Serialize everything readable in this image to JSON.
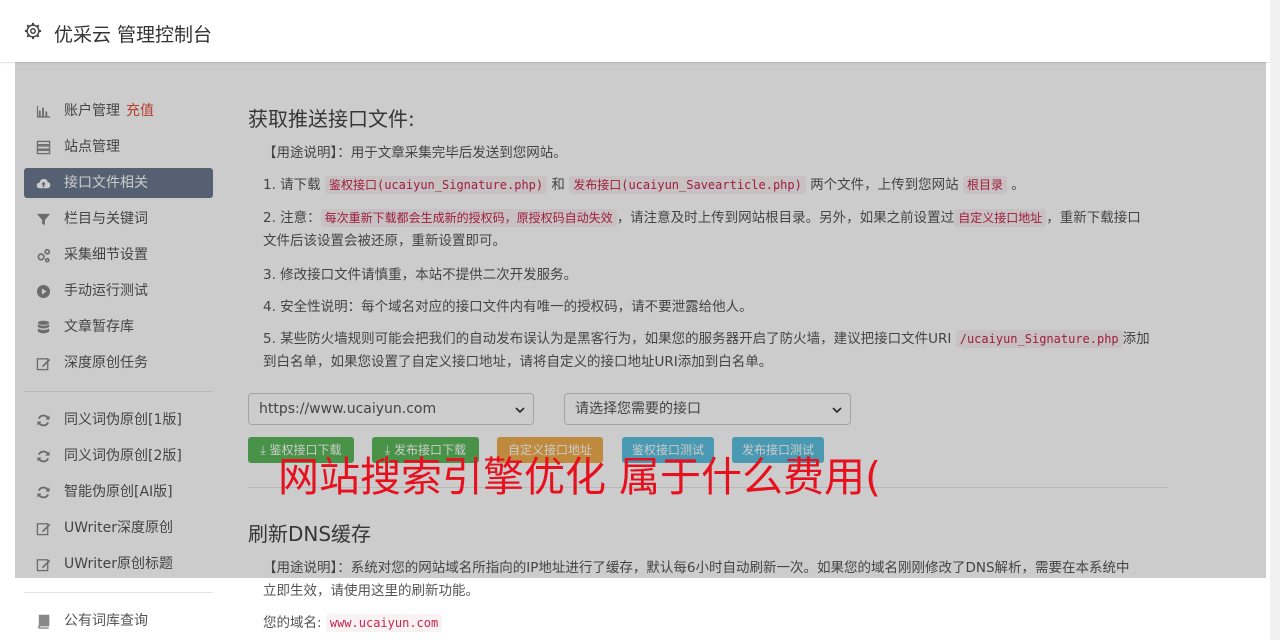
{
  "header": {
    "title": "优采云 管理控制台"
  },
  "sidebar": {
    "items": [
      {
        "label": "账户管理",
        "extra": "充值",
        "icon": "bar-chart-icon"
      },
      {
        "label": "站点管理",
        "icon": "server-icon"
      },
      {
        "label": "接口文件相关",
        "icon": "cloud-upload-icon",
        "active": true
      },
      {
        "label": "栏目与关键词",
        "icon": "filter-icon"
      },
      {
        "label": "采集细节设置",
        "icon": "cogs-icon"
      },
      {
        "label": "手动运行测试",
        "icon": "play-circle-icon"
      },
      {
        "label": "文章暂存库",
        "icon": "database-icon"
      },
      {
        "label": "深度原创任务",
        "icon": "edit-icon"
      },
      {
        "label": "同义词伪原创[1版]",
        "icon": "refresh-icon"
      },
      {
        "label": "同义词伪原创[2版]",
        "icon": "refresh-icon"
      },
      {
        "label": "智能伪原创[AI版]",
        "icon": "refresh-icon"
      },
      {
        "label": "UWriter深度原创",
        "icon": "edit-icon"
      },
      {
        "label": "UWriter原创标题",
        "icon": "edit-icon"
      },
      {
        "label": "公有词库查询",
        "icon": "book-icon"
      }
    ]
  },
  "main": {
    "section1_title": "获取推送接口文件:",
    "usage_label": "【用途说明】",
    "usage_text": "：用于文章采集完毕后发送到您网站。",
    "item1_a": "1. 请下载 ",
    "item1_code1": "鉴权接口(ucaiyun_Signature.php)",
    "item1_b": " 和 ",
    "item1_code2": "发布接口(ucaiyun_Savearticle.php)",
    "item1_c": " 两个文件，上传到您网站 ",
    "item1_code3": "根目录",
    "item1_d": " 。",
    "item2_a": "2. 注意：",
    "item2_code1": "每次重新下载都会生成新的授权码，原授权码自动失效",
    "item2_b": "，请注意及时上传到网站根目录。另外，如果之前设置过",
    "item2_code2": "自定义接口地址",
    "item2_c": "，重新下载接口文件后该设置会被还原，重新设置即可。",
    "item3": "3. 修改接口文件请慎重，本站不提供二次开发服务。",
    "item4": "4. 安全性说明：每个域名对应的接口文件内有唯一的授权码，请不要泄露给他人。",
    "item5_a": "5. 某些防火墙规则可能会把我们的自动发布误认为是黑客行为，如果您的服务器开启了防火墙，建议把接口文件URI ",
    "item5_code": "/ucaiyun_Signature.php",
    "item5_b": "添加到白名单，如果您设置了自定义接口地址，请将自定义的接口地址URI添加到白名单。",
    "site_select": "https://www.ucaiyun.com",
    "interface_select": "请选择您需要的接口",
    "buttons": [
      {
        "label": "鉴权接口下载",
        "color": "#5cb85c"
      },
      {
        "label": "发布接口下载",
        "color": "#5cb85c"
      },
      {
        "label": "自定义接口地址",
        "color": "#f0ad4e"
      },
      {
        "label": "鉴权接口测试",
        "color": "#5bc0de"
      },
      {
        "label": "发布接口测试",
        "color": "#5bc0de"
      }
    ],
    "section2_title": "刷新DNS缓存",
    "dns_usage_label": "【用途说明】",
    "dns_usage_text": "：系统对您的网站域名所指向的IP地址进行了缓存，默认每6小时自动刷新一次。如果您的域名刚刚修改了DNS解析，需要在本系统中立即生效，请使用这里的刷新功能。",
    "domain_label": "您的域名:",
    "domain_value": "www.ucaiyun.com"
  },
  "overlay_text": "网站搜索引擎优化 属于什么费用("
}
